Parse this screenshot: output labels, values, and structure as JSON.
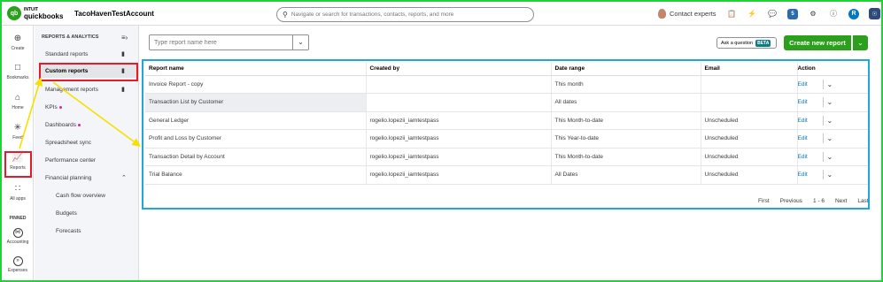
{
  "app": {
    "brand_top": "INTUIT",
    "brand_name": "quickbooks",
    "logo_glyph": "qb",
    "company": "TacoHavenTestAccount"
  },
  "search": {
    "placeholder": "Navigate or search for transactions, contacts, reports, and more"
  },
  "topbar": {
    "contact_label": "Contact experts",
    "icons": [
      "clipboard-icon",
      "lightning-icon",
      "chat-icon",
      "badge-icon",
      "gear-icon",
      "help-icon",
      "user-icon",
      "apps-icon"
    ],
    "badge_text": "5",
    "user_initial": "R"
  },
  "rail": {
    "items": [
      {
        "label": "Create",
        "icon": "plus-circle-icon"
      },
      {
        "label": "Bookmarks",
        "icon": "bookmark-icon"
      },
      {
        "label": "Home",
        "icon": "home-icon"
      },
      {
        "label": "Feed",
        "icon": "sparkle-icon"
      },
      {
        "label": "Reports",
        "icon": "chart-icon"
      },
      {
        "label": "All apps",
        "icon": "grid-icon"
      }
    ],
    "pinned_label": "PINNED",
    "pinned": [
      {
        "label": "Accounting",
        "icon": "accounting-icon"
      },
      {
        "label": "Expenses",
        "icon": "expenses-icon"
      }
    ]
  },
  "subnav": {
    "header": "REPORTS & ANALYTICS",
    "items": [
      {
        "label": "Standard reports",
        "bookmark": true
      },
      {
        "label": "Custom reports",
        "bookmark": true,
        "active": true
      },
      {
        "label": "Management reports",
        "bookmark": true
      },
      {
        "label": "KPIs",
        "dot": true
      },
      {
        "label": "Dashboards",
        "dot": true
      },
      {
        "label": "Spreadsheet sync"
      },
      {
        "label": "Performance center"
      },
      {
        "label": "Financial planning",
        "expanded": true
      },
      {
        "label": "Cash flow overview",
        "child": true
      },
      {
        "label": "Budgets",
        "child": true
      },
      {
        "label": "Forecasts",
        "child": true
      }
    ]
  },
  "main": {
    "report_search_placeholder": "Type report name here",
    "ask_label": "Ask a question",
    "beta_label": "BETA",
    "create_button": "Create new report"
  },
  "table": {
    "columns": [
      "Report name",
      "Created by",
      "Date range",
      "Email",
      "Action"
    ],
    "rows": [
      {
        "name": "Invoice Report - copy",
        "created_by": "",
        "date_range": "This month",
        "email": "",
        "action": "Edit"
      },
      {
        "name": "Transaction List by Customer",
        "created_by": "",
        "date_range": "All dates",
        "email": "",
        "action": "Edit"
      },
      {
        "name": "General Ledger",
        "created_by": "rogelio.lopezii_iamtestpass",
        "date_range": "This Month-to-date",
        "email": "Unscheduled",
        "action": "Edit"
      },
      {
        "name": "Profit and Loss by Customer",
        "created_by": "rogelio.lopezii_iamtestpass",
        "date_range": "This Year-to-date",
        "email": "Unscheduled",
        "action": "Edit"
      },
      {
        "name": "Transaction Detail by Account",
        "created_by": "rogelio.lopezii_iamtestpass",
        "date_range": "This Month-to-date",
        "email": "Unscheduled",
        "action": "Edit"
      },
      {
        "name": "Trial Balance",
        "created_by": "rogelio.lopezii_iamtestpass",
        "date_range": "All Dates",
        "email": "Unscheduled",
        "action": "Edit"
      }
    ]
  },
  "pager": {
    "first": "First",
    "previous": "Previous",
    "range": "1 - 6",
    "next": "Next",
    "last": "Last"
  },
  "colors": {
    "brand_green": "#2ca01c",
    "link_blue": "#0077c5",
    "highlight_red": "#e21c2a",
    "highlight_blue": "#20a8d8",
    "arrow_yellow": "#f5e000",
    "frame_green": "#22d135"
  }
}
